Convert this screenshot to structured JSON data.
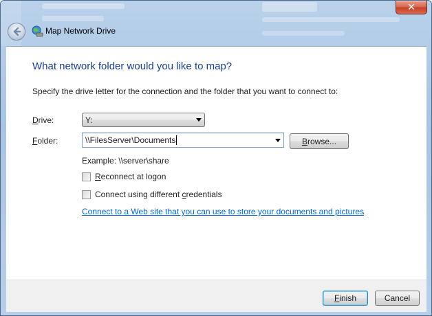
{
  "window": {
    "title": "Map Network Drive",
    "close_label": "✕"
  },
  "main": {
    "heading": "What network folder would you like to map?",
    "description": "Specify the drive letter for the connection and the folder that you want to connect to:",
    "drive": {
      "label_key": "D",
      "label_rest": "rive:",
      "value": "Y:"
    },
    "folder": {
      "label_key": "F",
      "label_rest": "older:",
      "value": "\\\\FilesServer\\Documents"
    },
    "browse": {
      "key": "B",
      "rest": "rowse..."
    },
    "example": "Example: \\\\server\\share",
    "reconnect": {
      "key": "R",
      "rest": "econnect at logon",
      "checked": false
    },
    "credentials": {
      "prefix": "Connect using different ",
      "key": "c",
      "rest": "redentials",
      "checked": false
    },
    "web_link": "Connect to a Web site that you can use to store your documents and pictures",
    "web_link_suffix": "."
  },
  "footer": {
    "finish": {
      "key": "F",
      "rest": "inish"
    },
    "cancel": "Cancel"
  },
  "colors": {
    "heading": "#1d3f8a",
    "link": "#0066cc",
    "close": "#c7432a"
  }
}
